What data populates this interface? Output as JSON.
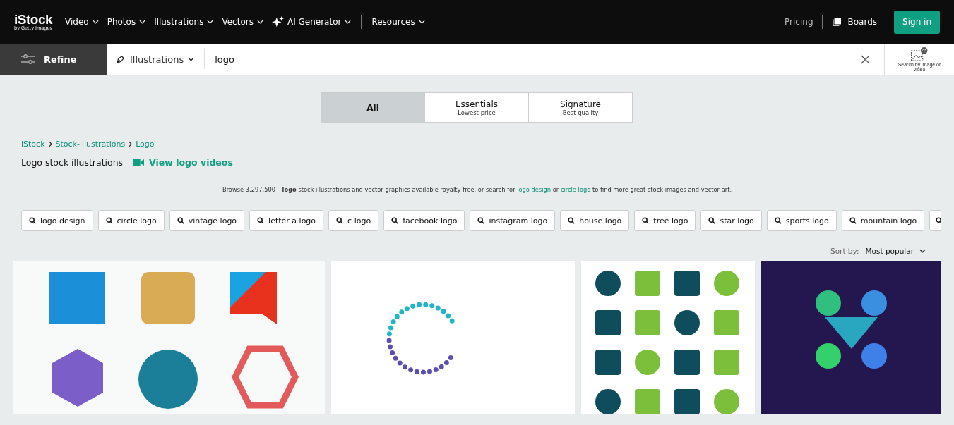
{
  "header": {
    "logo": "iStock",
    "logo_sub": "by Getty Images",
    "nav": [
      {
        "label": "Video",
        "kind": "menu"
      },
      {
        "label": "Photos",
        "kind": "menu"
      },
      {
        "label": "Illustrations",
        "kind": "menu"
      },
      {
        "label": "Vectors",
        "kind": "menu"
      },
      {
        "label": "AI Generator",
        "kind": "ai"
      },
      {
        "label": "Resources",
        "kind": "menu"
      }
    ],
    "pricing": "Pricing",
    "boards": "Boards",
    "sign_in": "Sign in"
  },
  "search": {
    "refine": "Refine",
    "type": "Illustrations",
    "value": "logo",
    "image_search": "Search by image or video"
  },
  "license_tabs": [
    {
      "label": "All",
      "selected": true
    },
    {
      "label": "Essentials",
      "sub": "Lowest price",
      "selected": false
    },
    {
      "label": "Signature",
      "sub": "Best quality",
      "selected": false
    }
  ],
  "breadcrumbs": [
    "iStock",
    "Stock-illustrations",
    "Logo"
  ],
  "heading": "Logo stock illustrations",
  "videos_link": "View logo videos",
  "browse": [
    {
      "kind": "text",
      "text": "Browse 3,297,500+ **logo** stock illustrations and vector graphics available royalty-free, or search for "
    },
    {
      "kind": "link",
      "text": "logo design"
    },
    {
      "kind": "text",
      "text": " or "
    },
    {
      "kind": "link",
      "text": "circle logo"
    },
    {
      "kind": "text",
      "text": " to find more great stock images and vector art."
    }
  ],
  "related": [
    "logo design",
    "circle logo",
    "vintage logo",
    "letter a logo",
    "c logo",
    "facebook logo",
    "instagram logo",
    "house logo",
    "tree logo",
    "star logo",
    "sports logo",
    "mountain logo"
  ],
  "related_more_chip": true,
  "sort": {
    "label": "Sort by:",
    "value": "Most popular"
  },
  "results": [
    {
      "kind": "logo-set"
    },
    {
      "kind": "circle-logo"
    },
    {
      "kind": "pattern"
    },
    {
      "kind": "teamwork"
    }
  ]
}
